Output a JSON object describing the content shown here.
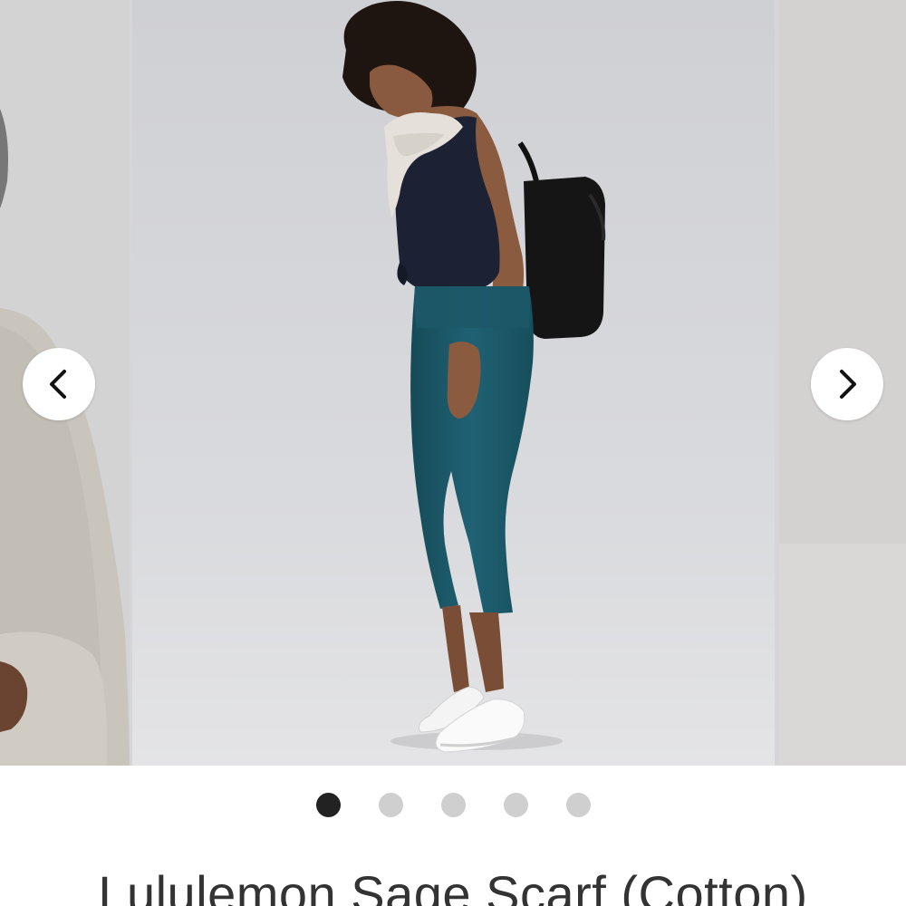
{
  "carousel": {
    "prev_button": {
      "icon": "chevron-left-icon"
    },
    "next_button": {
      "icon": "chevron-right-icon"
    },
    "slide_count": 5,
    "active_index": 0
  },
  "product": {
    "title": "Lululemon Sage Scarf (Cotton)"
  },
  "colors": {
    "dot_active": "#222222",
    "dot_inactive": "#cfcfcf",
    "leggings": "#1f5f70",
    "tank": "#1c2133",
    "scarf": "#e6e3dc",
    "bag": "#141414"
  }
}
